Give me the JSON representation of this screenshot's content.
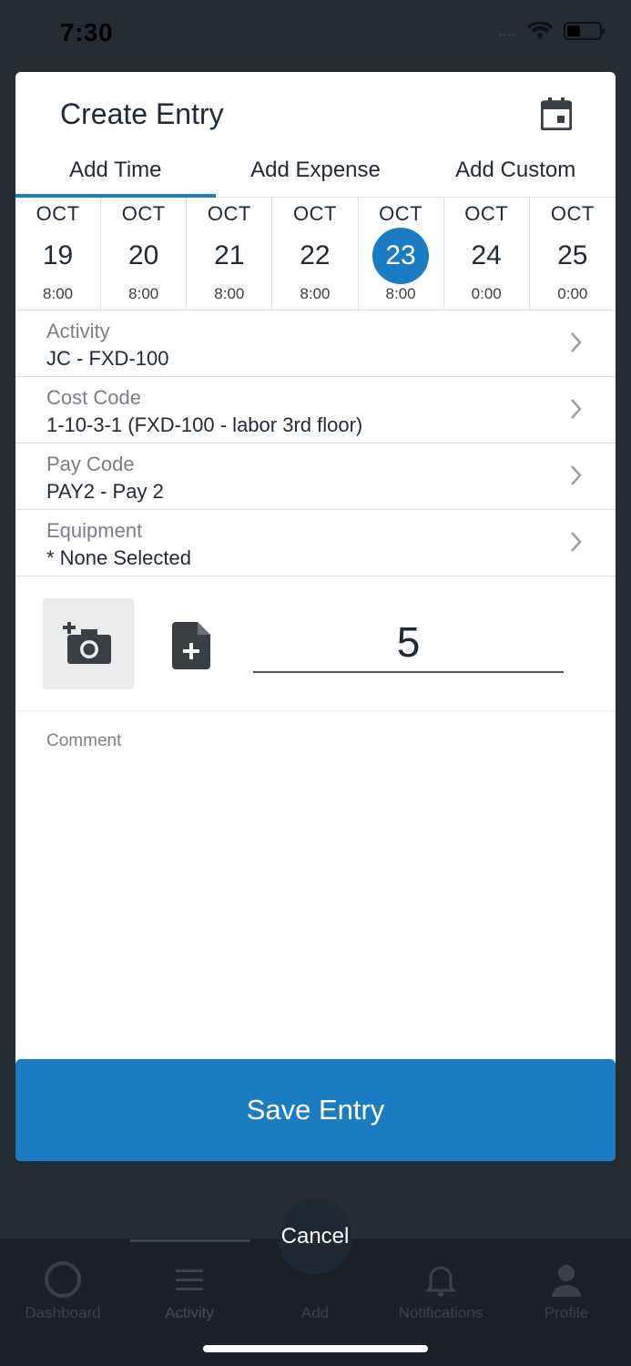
{
  "status": {
    "time": "7:30",
    "dots": "....",
    "battery_level": 0.3
  },
  "modal": {
    "title": "Create Entry",
    "tabs": [
      {
        "label": "Add Time",
        "active": true
      },
      {
        "label": "Add Expense",
        "active": false
      },
      {
        "label": "Add Custom",
        "active": false
      }
    ],
    "days": [
      {
        "month": "OCT",
        "day": "19",
        "hours": "8:00"
      },
      {
        "month": "OCT",
        "day": "20",
        "hours": "8:00"
      },
      {
        "month": "OCT",
        "day": "21",
        "hours": "8:00"
      },
      {
        "month": "OCT",
        "day": "22",
        "hours": "8:00"
      },
      {
        "month": "OCT",
        "day": "23",
        "hours": "8:00",
        "selected": true
      },
      {
        "month": "OCT",
        "day": "24",
        "hours": "0:00"
      },
      {
        "month": "OCT",
        "day": "25",
        "hours": "0:00"
      }
    ],
    "fields": [
      {
        "label": "Activity",
        "value": "JC - FXD-100"
      },
      {
        "label": "Cost Code",
        "value": "1-10-3-1 (FXD-100 - labor 3rd floor)"
      },
      {
        "label": "Pay Code",
        "value": "PAY2 - Pay 2"
      },
      {
        "label": "Equipment",
        "value": "* None Selected"
      }
    ],
    "hours_value": "5",
    "comment_placeholder": "Comment",
    "save_label": "Save Entry"
  },
  "tabbar": {
    "items": [
      {
        "label": "Dashboard",
        "icon": "dashboard-icon"
      },
      {
        "label": "Activity",
        "icon": "list-icon"
      },
      {
        "label": "Add",
        "icon": "add-icon"
      },
      {
        "label": "Notifications",
        "icon": "bell-icon"
      },
      {
        "label": "Profile",
        "icon": "person-icon"
      }
    ],
    "cancel_label": "Cancel"
  },
  "colors": {
    "accent": "#1a7cc3",
    "text": "#1f2a35",
    "muted": "#7a7f85",
    "backdrop": "#262c33"
  }
}
